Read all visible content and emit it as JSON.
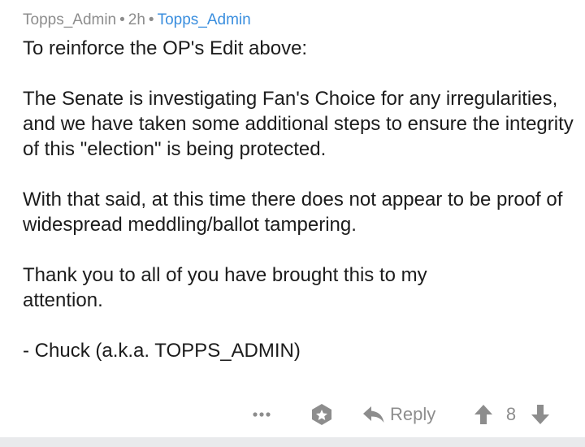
{
  "comment": {
    "author": "Topps_Admin",
    "separator": "•",
    "age": "2h",
    "flair": "Topps_Admin",
    "paragraphs": [
      "To reinforce the OP's Edit above:",
      "The Senate is investigating Fan's Choice for any irregularities, and we have taken some additional steps to ensure the integrity of this \"election\" is being protected.",
      "With that said, at this time there does not appear to be proof of widespread meddling/ballot tampering.",
      "Thank you to all of you have brought this to my attention.",
      "- Chuck (a.k.a. TOPPS_ADMIN)"
    ]
  },
  "actions": {
    "more_icon": "more-dots-icon",
    "gild_icon": "gild-icon",
    "reply_icon": "reply-arrow-icon",
    "reply_label": "Reply",
    "upvote_icon": "upvote-arrow-icon",
    "score": "8",
    "downvote_icon": "downvote-arrow-icon"
  },
  "colors": {
    "meta_gray": "#8d8d8d",
    "flair_blue": "#3a8ede",
    "text": "#1c1c1c",
    "footer_bar": "#e9eaec"
  }
}
